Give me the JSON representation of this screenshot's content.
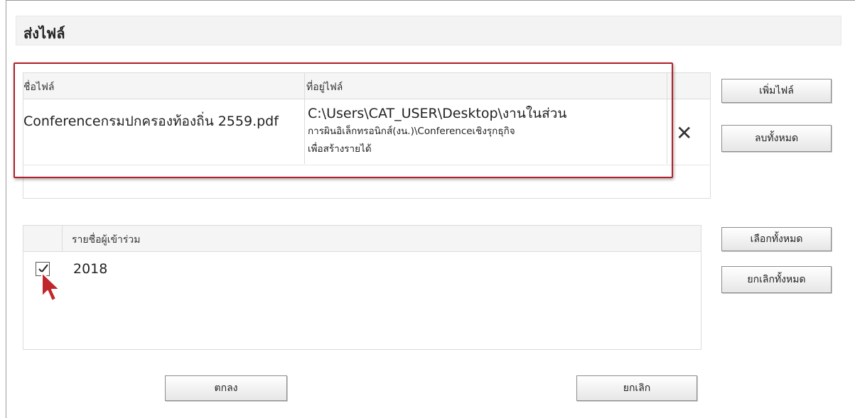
{
  "dialog": {
    "title": "ส่งไฟล์"
  },
  "files": {
    "header_name": "ชื่อไฟล์",
    "header_path": "ที่อยู่ไฟล์",
    "rows": [
      {
        "name": "Conferenceกรมปกครองท้องถิ่น 2559.pdf",
        "path_line1": "C:\\Users\\CAT_USER\\Desktop\\งานในส่วน",
        "path_line2": "การผินอิเล็กทรอนิกส์(งน.)\\Conferenceเชิงรุกธุกิจ",
        "path_line3": "เพื่อสร้างรายได้"
      }
    ],
    "delete_glyph": "✕"
  },
  "buttons": {
    "add_file": "เพิ่มไฟล์",
    "remove_all": "ลบทั้งหมด",
    "select_all": "เลือกทั้งหมด",
    "deselect_all": "ยกเลิกทั้งหมด",
    "ok": "ตกลง",
    "cancel": "ยกเลิก"
  },
  "participants": {
    "header": "รายชื่อผู้เข้าร่วม",
    "items": [
      {
        "name": "2018",
        "checked": true
      }
    ]
  },
  "colors": {
    "highlight": "#b0202a"
  }
}
